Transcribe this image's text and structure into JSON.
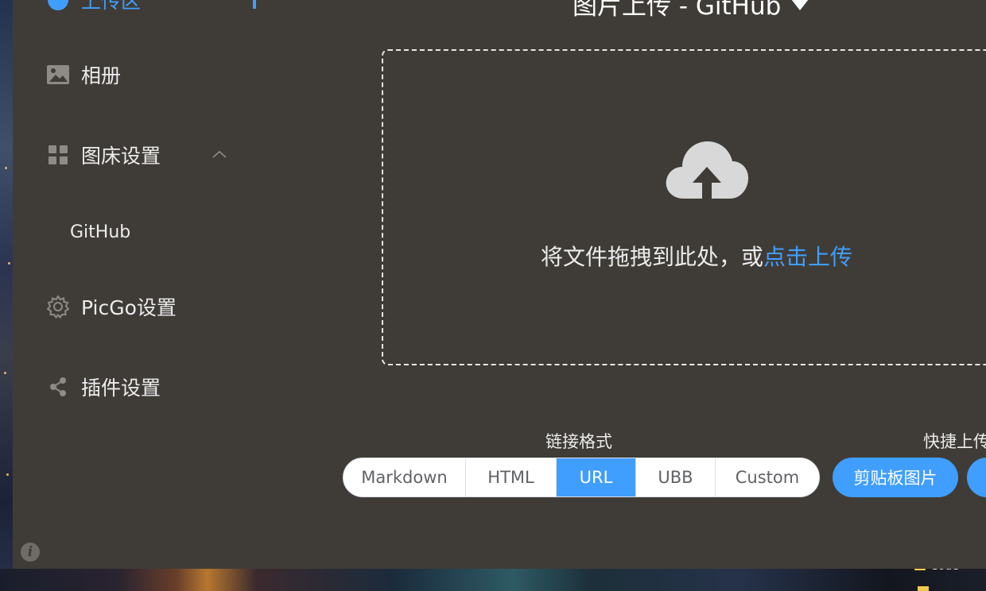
{
  "sidebar": {
    "items": [
      {
        "label": "上传区",
        "icon": "upload-icon",
        "active": true
      },
      {
        "label": "相册",
        "icon": "image-icon"
      },
      {
        "label": "图床设置",
        "icon": "grid-icon",
        "expanded": true
      },
      {
        "label": "PicGo设置",
        "icon": "gear-icon"
      },
      {
        "label": "插件设置",
        "icon": "share-icon"
      }
    ],
    "sub_items": [
      {
        "label": "GitHub"
      }
    ],
    "active_color": "#409eff"
  },
  "header": {
    "title": "图片上传 - GitHub"
  },
  "upload": {
    "drop_text": "将文件拖拽到此处，或 ",
    "drop_link": "点击上传"
  },
  "link_format": {
    "label": "链接格式",
    "options": [
      "Markdown",
      "HTML",
      "URL",
      "UBB",
      "Custom"
    ],
    "selected": "URL"
  },
  "quick_upload": {
    "label": "快捷上传",
    "buttons": [
      "剪贴板图片"
    ]
  },
  "desktop": {
    "file_label": "Code"
  },
  "colors": {
    "window_bg": "#3f3c37",
    "accent": "#409eff",
    "text": "#ececec"
  }
}
